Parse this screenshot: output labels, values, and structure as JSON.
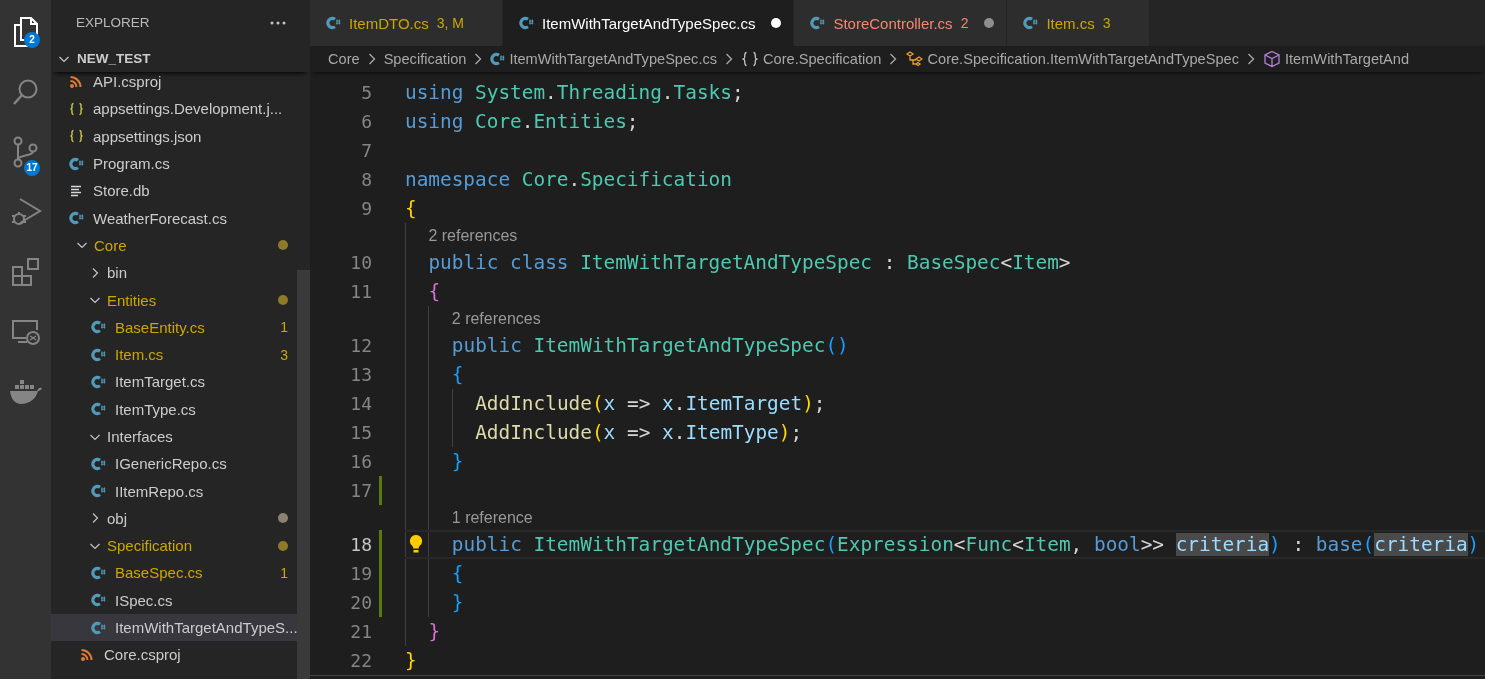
{
  "activity_bar": [
    {
      "kind": "explorer",
      "selected": true,
      "badge": "2"
    },
    {
      "kind": "search",
      "selected": false
    },
    {
      "kind": "source-control",
      "selected": false,
      "badge": "17"
    },
    {
      "kind": "run-debug",
      "selected": false
    },
    {
      "kind": "extensions",
      "selected": false
    },
    {
      "kind": "remote-explorer",
      "selected": false
    },
    {
      "kind": "docker",
      "selected": false
    }
  ],
  "explorer": {
    "title": "EXPLORER",
    "section": {
      "title": "NEW_TEST",
      "expanded": true
    },
    "tree": [
      {
        "label": "API.csproj",
        "kind": "project",
        "selected": false,
        "modified": false
      },
      {
        "label": "appsettings.Development.j...",
        "kind": "json",
        "selected": false,
        "modified": false
      },
      {
        "label": "appsettings.json",
        "kind": "json",
        "selected": false,
        "modified": false
      },
      {
        "label": "Program.cs",
        "kind": "csharp",
        "selected": false,
        "modified": false
      },
      {
        "label": "Store.db",
        "kind": "text",
        "selected": false,
        "modified": false
      },
      {
        "label": "WeatherForecast.cs",
        "kind": "csharp",
        "selected": false,
        "modified": false
      },
      {
        "label": "Core",
        "kind": "folder",
        "expanded": true,
        "selected": false,
        "modified": true,
        "color": "#8f7a2a",
        "children": [
          {
            "label": "bin",
            "kind": "folder",
            "expanded": false,
            "selected": false,
            "modified": false
          },
          {
            "label": "Entities",
            "kind": "folder",
            "expanded": true,
            "selected": false,
            "modified": true,
            "color": "#8f7a2a",
            "children": [
              {
                "label": "BaseEntity.cs",
                "kind": "csharp",
                "selected": false,
                "modified": true,
                "count": "1"
              },
              {
                "label": "Item.cs",
                "kind": "csharp",
                "selected": false,
                "modified": true,
                "count": "3"
              },
              {
                "label": "ItemTarget.cs",
                "kind": "csharp",
                "selected": false,
                "modified": false
              },
              {
                "label": "ItemType.cs",
                "kind": "csharp",
                "selected": false,
                "modified": false
              }
            ]
          },
          {
            "label": "Interfaces",
            "kind": "folder",
            "expanded": true,
            "selected": false,
            "modified": false,
            "children": [
              {
                "label": "IGenericRepo.cs",
                "kind": "csharp",
                "selected": false,
                "modified": false
              },
              {
                "label": "IItemRepo.cs",
                "kind": "csharp",
                "selected": false,
                "modified": false
              }
            ]
          },
          {
            "label": "obj",
            "kind": "folder",
            "expanded": false,
            "selected": false,
            "modified": false,
            "color": "#8c8170"
          },
          {
            "label": "Specification",
            "kind": "folder",
            "expanded": true,
            "selected": false,
            "modified": true,
            "color": "#8f7a2a",
            "children": [
              {
                "label": "BaseSpec.cs",
                "kind": "csharp",
                "selected": false,
                "modified": true,
                "count": "1"
              },
              {
                "label": "ISpec.cs",
                "kind": "csharp",
                "selected": false,
                "modified": false
              },
              {
                "label": "ItemWithTargetAndTypeS...",
                "kind": "csharp",
                "selected": true,
                "modified": false
              }
            ]
          },
          {
            "label": "Core.csproj",
            "kind": "project",
            "selected": false,
            "modified": false
          }
        ]
      }
    ]
  },
  "tabs": [
    {
      "label": "ItemDTO.cs",
      "warning": true,
      "error": false,
      "badge": "3, M",
      "dirty": false,
      "selected": false
    },
    {
      "label": "ItemWithTargetAndTypeSpec.cs",
      "warning": false,
      "error": false,
      "dirty": true,
      "selected": true
    },
    {
      "label": "StoreController.cs",
      "warning": false,
      "error": true,
      "badge": "2",
      "dirty": true,
      "selected": false
    },
    {
      "label": "Item.cs",
      "warning": true,
      "error": false,
      "badge": "3",
      "dirty": false,
      "selected": false
    }
  ],
  "breadcrumbs": [
    {
      "kind": "folder",
      "label": "Core"
    },
    {
      "kind": "folder",
      "label": "Specification"
    },
    {
      "kind": "file",
      "label": "ItemWithTargetAndTypeSpec.cs"
    },
    {
      "kind": "namespace",
      "label": "Core.Specification"
    },
    {
      "kind": "class",
      "label": "Core.Specification.ItemWithTargetAndTypeSpec"
    },
    {
      "kind": "constructor",
      "label": "ItemWithTargetAnd"
    }
  ],
  "editor": {
    "lines": [
      {
        "kind": "code",
        "number": "5",
        "changed": false,
        "current": false,
        "lightbulb": false,
        "tokens": [
          {
            "kind": "keyword",
            "text": "using "
          },
          {
            "kind": "type",
            "text": "System"
          },
          {
            "kind": "plain",
            "text": "."
          },
          {
            "kind": "type",
            "text": "Threading"
          },
          {
            "kind": "plain",
            "text": "."
          },
          {
            "kind": "type",
            "text": "Tasks"
          },
          {
            "kind": "plain",
            "text": ";"
          }
        ]
      },
      {
        "kind": "code",
        "number": "6",
        "changed": false,
        "current": false,
        "lightbulb": false,
        "tokens": [
          {
            "kind": "keyword",
            "text": "using "
          },
          {
            "kind": "type",
            "text": "Core"
          },
          {
            "kind": "plain",
            "text": "."
          },
          {
            "kind": "type",
            "text": "Entities"
          },
          {
            "kind": "plain",
            "text": ";"
          }
        ]
      },
      {
        "kind": "code",
        "number": "7",
        "changed": false,
        "current": false,
        "lightbulb": false
      },
      {
        "kind": "code",
        "number": "8",
        "changed": false,
        "current": false,
        "lightbulb": false,
        "tokens": [
          {
            "kind": "keyword",
            "text": "namespace "
          },
          {
            "kind": "type",
            "text": "Core"
          },
          {
            "kind": "plain",
            "text": "."
          },
          {
            "kind": "type",
            "text": "Specification"
          }
        ]
      },
      {
        "kind": "code",
        "number": "9",
        "changed": false,
        "current": false,
        "lightbulb": false,
        "tokens": [
          {
            "kind": "brace1",
            "text": "{"
          }
        ]
      },
      {
        "kind": "codelens",
        "text": "2 references"
      },
      {
        "kind": "code",
        "number": "10",
        "changed": false,
        "current": false,
        "lightbulb": false,
        "tokens": [
          {
            "kind": "keyword",
            "text": "  public class "
          },
          {
            "kind": "type",
            "text": "ItemWithTargetAndTypeSpec"
          },
          {
            "kind": "plain",
            "text": " : "
          },
          {
            "kind": "type",
            "text": "BaseSpec"
          },
          {
            "kind": "plain",
            "text": "<"
          },
          {
            "kind": "type",
            "text": "Item"
          },
          {
            "kind": "plain",
            "text": ">"
          }
        ]
      },
      {
        "kind": "code",
        "number": "11",
        "changed": false,
        "current": false,
        "lightbulb": false,
        "tokens": [
          {
            "kind": "brace2",
            "text": "  {"
          }
        ]
      },
      {
        "kind": "codelens",
        "text": "2 references"
      },
      {
        "kind": "code",
        "number": "12",
        "changed": false,
        "current": false,
        "lightbulb": false,
        "tokens": [
          {
            "kind": "keyword",
            "text": "    public "
          },
          {
            "kind": "type",
            "text": "ItemWithTargetAndTypeSpec"
          },
          {
            "kind": "brace3",
            "text": "()"
          }
        ]
      },
      {
        "kind": "code",
        "number": "13",
        "changed": false,
        "current": false,
        "lightbulb": false,
        "tokens": [
          {
            "kind": "brace3",
            "text": "    {"
          }
        ]
      },
      {
        "kind": "code",
        "number": "14",
        "changed": false,
        "current": false,
        "lightbulb": false,
        "tokens": [
          {
            "kind": "function",
            "text": "      AddInclude"
          },
          {
            "kind": "brace1",
            "text": "("
          },
          {
            "kind": "variable",
            "text": "x"
          },
          {
            "kind": "plain",
            "text": " => "
          },
          {
            "kind": "variable",
            "text": "x"
          },
          {
            "kind": "plain",
            "text": "."
          },
          {
            "kind": "variable",
            "text": "ItemTarget"
          },
          {
            "kind": "brace1",
            "text": ")"
          },
          {
            "kind": "plain",
            "text": ";"
          }
        ]
      },
      {
        "kind": "code",
        "number": "15",
        "changed": false,
        "current": false,
        "lightbulb": false,
        "tokens": [
          {
            "kind": "function",
            "text": "      AddInclude"
          },
          {
            "kind": "brace1",
            "text": "("
          },
          {
            "kind": "variable",
            "text": "x"
          },
          {
            "kind": "plain",
            "text": " => "
          },
          {
            "kind": "variable",
            "text": "x"
          },
          {
            "kind": "plain",
            "text": "."
          },
          {
            "kind": "variable",
            "text": "ItemType"
          },
          {
            "kind": "brace1",
            "text": ")"
          },
          {
            "kind": "plain",
            "text": ";"
          }
        ]
      },
      {
        "kind": "code",
        "number": "16",
        "changed": false,
        "current": false,
        "lightbulb": false,
        "tokens": [
          {
            "kind": "brace3",
            "text": "    }"
          }
        ]
      },
      {
        "kind": "code",
        "number": "17",
        "changed": true,
        "current": false,
        "lightbulb": false
      },
      {
        "kind": "codelens",
        "text": "1 reference"
      },
      {
        "kind": "code",
        "number": "18",
        "changed": true,
        "current": true,
        "lightbulb": true,
        "tokens": [
          {
            "kind": "keyword",
            "text": "    public "
          },
          {
            "kind": "type",
            "text": "ItemWithTargetAndTypeSpec"
          },
          {
            "kind": "brace3",
            "text": "("
          },
          {
            "kind": "type",
            "text": "Expression"
          },
          {
            "kind": "plain",
            "text": "<"
          },
          {
            "kind": "type",
            "text": "Func"
          },
          {
            "kind": "plain",
            "text": "<"
          },
          {
            "kind": "type",
            "text": "Item"
          },
          {
            "kind": "plain",
            "text": ", "
          },
          {
            "kind": "keyword",
            "text": "bool"
          },
          {
            "kind": "plain",
            "text": ">> "
          },
          {
            "kind": "highlight",
            "text": "criteria"
          },
          {
            "kind": "brace3",
            "text": ")"
          },
          {
            "kind": "plain",
            "text": " : "
          },
          {
            "kind": "keyword",
            "text": "base"
          },
          {
            "kind": "brace3",
            "text": "("
          },
          {
            "kind": "highlight",
            "text": "criteria"
          },
          {
            "kind": "brace3",
            "text": ")"
          }
        ]
      },
      {
        "kind": "code",
        "number": "19",
        "changed": true,
        "current": false,
        "lightbulb": false,
        "tokens": [
          {
            "kind": "brace3",
            "text": "    {"
          }
        ]
      },
      {
        "kind": "code",
        "number": "20",
        "changed": true,
        "current": false,
        "lightbulb": false,
        "tokens": [
          {
            "kind": "brace3",
            "text": "    }"
          }
        ]
      },
      {
        "kind": "code",
        "number": "21",
        "changed": false,
        "current": false,
        "lightbulb": false,
        "tokens": [
          {
            "kind": "brace2",
            "text": "  }"
          }
        ]
      },
      {
        "kind": "code",
        "number": "22",
        "changed": false,
        "current": false,
        "lightbulb": false,
        "tokens": [
          {
            "kind": "brace1",
            "text": "}"
          }
        ]
      }
    ]
  }
}
